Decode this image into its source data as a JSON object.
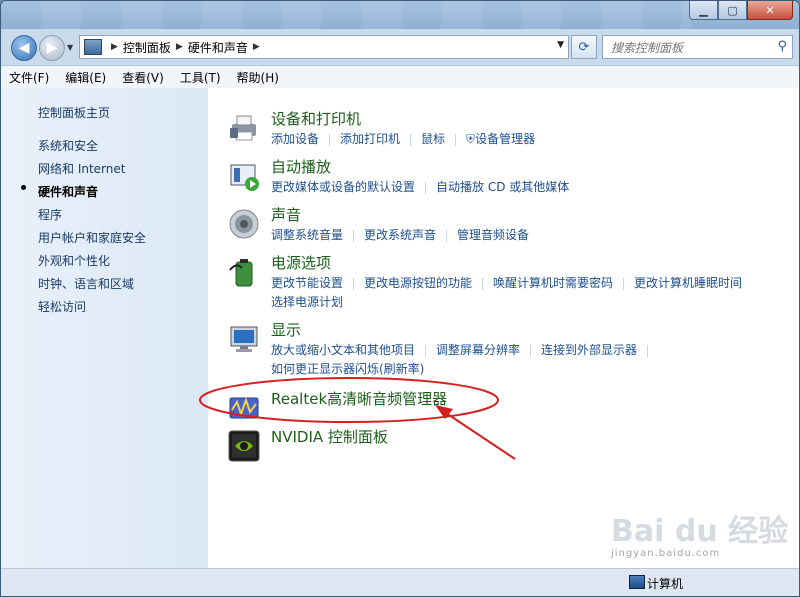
{
  "window": {
    "caption_buttons": {
      "minimize_icon": "minimize-icon",
      "maximize_icon": "maximize-icon",
      "close_icon": "close-icon"
    }
  },
  "address_bar": {
    "breadcrumbs": [
      "控制面板",
      "硬件和声音"
    ],
    "search_placeholder": "搜索控制面板"
  },
  "menu": [
    "文件(F)",
    "编辑(E)",
    "查看(V)",
    "工具(T)",
    "帮助(H)"
  ],
  "sidebar": {
    "home": "控制面板主页",
    "items": [
      "系统和安全",
      "网络和 Internet",
      "硬件和声音",
      "程序",
      "用户帐户和家庭安全",
      "外观和个性化",
      "时钟、语言和区域",
      "轻松访问"
    ],
    "active_index": 2
  },
  "categories": [
    {
      "title": "设备和打印机",
      "icon": "printer-icon",
      "links": [
        "添加设备",
        "添加打印机",
        "鼠标",
        "设备管理器"
      ]
    },
    {
      "title": "自动播放",
      "icon": "autoplay-icon",
      "links": [
        "更改媒体或设备的默认设置",
        "自动播放 CD 或其他媒体"
      ]
    },
    {
      "title": "声音",
      "icon": "speaker-icon",
      "links": [
        "调整系统音量",
        "更改系统声音",
        "管理音频设备"
      ]
    },
    {
      "title": "电源选项",
      "icon": "battery-icon",
      "links": [
        "更改节能设置",
        "更改电源按钮的功能",
        "唤醒计算机时需要密码",
        "更改计算机睡眠时间"
      ],
      "links2": [
        "选择电源计划"
      ]
    },
    {
      "title": "显示",
      "icon": "monitor-icon",
      "links": [
        "放大或缩小文本和其他项目",
        "调整屏幕分辨率",
        "连接到外部显示器"
      ],
      "links2": [
        "如何更正显示器闪烁(刷新率)"
      ]
    },
    {
      "title": "Realtek高清晰音频管理器",
      "icon": "realtek-audio-icon",
      "links": []
    },
    {
      "title": "NVIDIA 控制面板",
      "icon": "nvidia-icon",
      "links": []
    }
  ],
  "status_bar": {
    "computer_label": "计算机"
  },
  "annotation": {
    "color": "#d62020"
  },
  "watermark": {
    "text": "Bai du 经验",
    "subtext": "jingyan.baidu.com"
  }
}
